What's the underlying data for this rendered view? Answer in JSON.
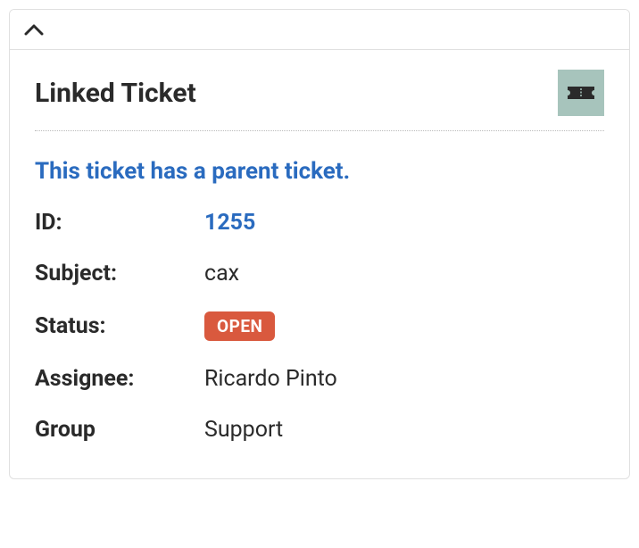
{
  "panel": {
    "title": "Linked Ticket",
    "notice": "This ticket has a parent ticket.",
    "icon_name": "ticket-icon"
  },
  "fields": {
    "id": {
      "label": "ID:",
      "value": "1255"
    },
    "subject": {
      "label": "Subject:",
      "value": "cax"
    },
    "status": {
      "label": "Status:",
      "value": "OPEN"
    },
    "assignee": {
      "label": "Assignee:",
      "value": "Ricardo Pinto"
    },
    "group": {
      "label": "Group",
      "value": "Support"
    }
  },
  "colors": {
    "accent_blue": "#2a6bbf",
    "status_open": "#d9593e",
    "icon_bg": "#a7c4bc"
  }
}
